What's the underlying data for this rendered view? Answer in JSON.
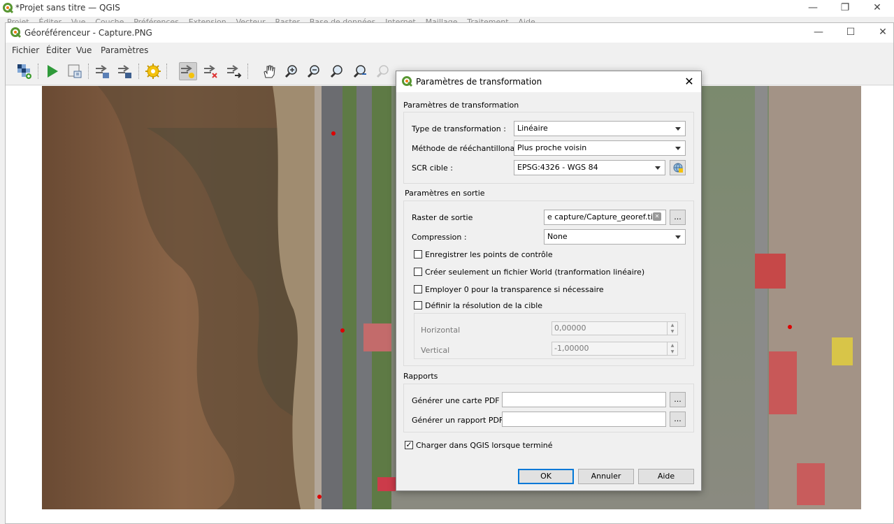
{
  "main_window": {
    "title": "*Projet sans titre — QGIS",
    "menu": [
      "Projet",
      "Éditer",
      "Vue",
      "Couche",
      "Préférences",
      "Extension",
      "Vecteur",
      "Raster",
      "Base de données",
      "Internet",
      "Maillage",
      "Traitement",
      "Aide"
    ]
  },
  "geo_window": {
    "title": "Géoréférenceur - Capture.PNG",
    "menu": [
      "Fichier",
      "Éditer",
      "Vue",
      "Paramètres"
    ]
  },
  "toolbar_icons": [
    "open-raster-icon",
    "start-georeferencing-icon",
    "generate-gdal-script-icon",
    "load-gcp-icon",
    "save-gcp-icon",
    "transformation-settings-icon",
    "add-point-icon",
    "delete-point-icon",
    "move-point-icon",
    "pan-icon",
    "zoom-in-icon",
    "zoom-out-icon",
    "zoom-to-layer-icon",
    "zoom-last-icon",
    "zoom-next-icon",
    "link-georef-to-qgis-icon",
    "link-qgis-to-georef-icon",
    "full-histogram-stretch-icon",
    "local-histogram-stretch-icon"
  ],
  "dialog": {
    "title": "Paramètres de transformation",
    "close": "✕",
    "section_transform": "Paramètres de transformation",
    "transform_type_label": "Type de transformation :",
    "transform_type_value": "Linéaire",
    "resampling_label": "Méthode de rééchantillonage",
    "resampling_value": "Plus proche voisin",
    "target_crs_label": "SCR cible :",
    "target_crs_value": "EPSG:4326 - WGS 84",
    "section_output": "Paramètres en sortie",
    "output_raster_label": "Raster de sortie",
    "output_raster_value": "e capture/Capture_georef.tif",
    "browse": "...",
    "compression_label": "Compression :",
    "compression_value": "None",
    "save_gcp_label": "Enregistrer les points de contrôle",
    "world_file_label": "Créer seulement un fichier World (tranformation linéaire)",
    "use_zero_label": "Employer 0 pour la transparence si nécessaire",
    "set_resolution_label": "Définir la résolution de la cible",
    "horizontal_label": "Horizontal",
    "horizontal_value": "0,00000",
    "vertical_label": "Vertical",
    "vertical_value": "-1,00000",
    "section_reports": "Rapports",
    "pdf_map_label": "Générer une carte PDF :",
    "pdf_report_label": "Générer un rapport PDF :",
    "load_in_qgis_label": "Charger dans QGIS lorsque terminé",
    "load_in_qgis_checked": "✓",
    "ok": "OK",
    "cancel": "Annuler",
    "help": "Aide"
  },
  "window_controls": {
    "minimize": "—",
    "maximize": "☐",
    "restore": "❐",
    "close": "✕"
  }
}
